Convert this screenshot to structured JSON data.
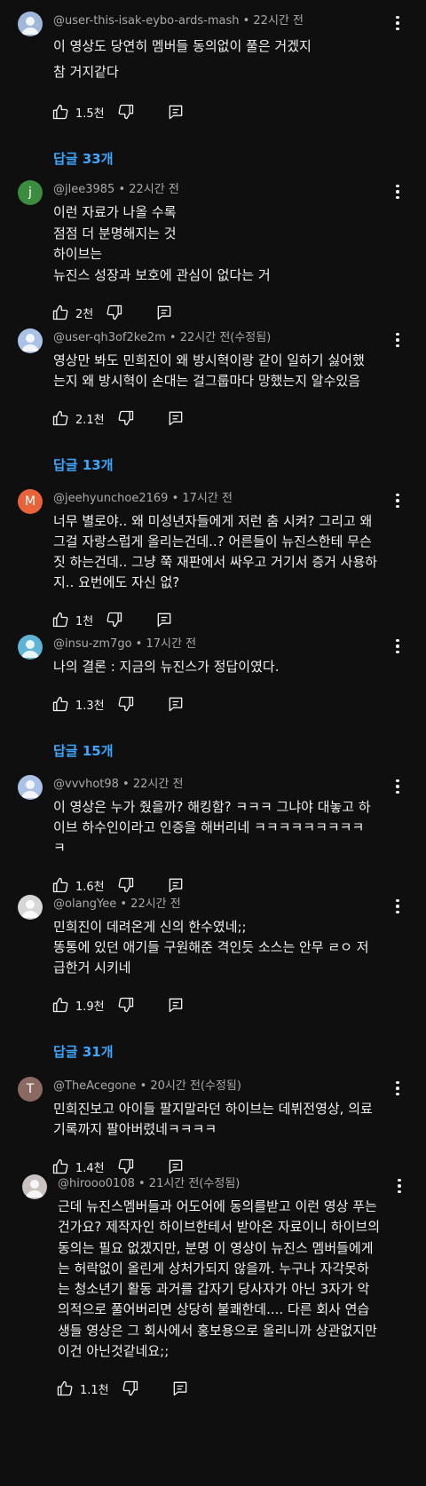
{
  "comments": [
    {
      "handle": "@user-this-isak-eybo-ards-mash",
      "time": "22시간 전",
      "avatar_letter": "",
      "avatar_color": "#9fb8d8",
      "lines": [
        "이 영상도 당연히 멤버들 동의없이 풀은 거겠지",
        "참 거지같다"
      ],
      "likes": "1.5천",
      "replies": "답글 33개"
    },
    {
      "handle": "@jlee3985",
      "time": "22시간 전",
      "avatar_letter": "j",
      "avatar_color": "#3b8c3f",
      "lines": [
        "이런 자료가 나올 수록",
        "점점 더 분명해지는 것",
        "하이브는",
        "뉴진스 성장과 보호에 관심이 없다는 거"
      ],
      "likes": "2천",
      "replies": ""
    },
    {
      "handle": "@user-qh3of2ke2m",
      "time": "22시간 전(수정됨)",
      "avatar_letter": "",
      "avatar_color": "#a9c2e6",
      "lines": [
        "영상만 봐도 민희진이 왜 방시혁이랑 같이 일하기 싫어했",
        "는지  왜 방시혁이 손대는 걸그룹마다 망했는지 알수있음"
      ],
      "likes": "2.1천",
      "replies": "답글 13개"
    },
    {
      "handle": "@jeehyunchoe2169",
      "time": "17시간 전",
      "avatar_letter": "M",
      "avatar_color": "#e8623a",
      "lines": [
        "너무 별로야.. 왜 미성년자들에게 저런 춤 시켜? 그리고 왜",
        "그걸 자랑스럽게 올리는건데..? 어른들이 뉴진스한테 무슨",
        "짓 하는건데.. 그냥 쭉 재판에서 싸우고 거기서 증거 사용하",
        "지.. 요번에도 자신 없?"
      ],
      "likes": "1천",
      "replies": ""
    },
    {
      "handle": "@insu-zm7go",
      "time": "17시간 전",
      "avatar_letter": "",
      "avatar_color": "#5fb3d4",
      "lines": [
        "나의 결론 : 지금의 뉴진스가 정답이였다."
      ],
      "likes": "1.3천",
      "replies": "답글 15개"
    },
    {
      "handle": "@vvvhot98",
      "time": "22시간 전",
      "avatar_letter": "",
      "avatar_color": "#a9c2e6",
      "lines": [
        "이 영상은 누가 줬을까? 해킹함? ㅋㅋㅋ 그냐야 대놓고 하",
        "이브 하수인이라고 인증을 해버리네 ㅋㅋㅋㅋㅋㅋㅋㅋㅋ",
        "ㅋ"
      ],
      "likes": "1.6천",
      "replies": ""
    },
    {
      "handle": "@olangYee",
      "time": "22시간 전",
      "avatar_letter": "",
      "avatar_color": "#d6d6d6",
      "lines": [
        "민희진이 데려온게 신의 한수였네;;",
        "똥통에 있던 애기들 구원해준 격인듯 소스는 안무 ㄹㅇ 저",
        "급한거 시키네"
      ],
      "likes": "1.9천",
      "replies": "답글 31개"
    },
    {
      "handle": "@TheAcegone",
      "time": "20시간 전(수정됨)",
      "avatar_letter": "T",
      "avatar_color": "#8a6a60",
      "lines": [
        "민희진보고 아이들 팔지말라던 하이브는 데뷔전영상, 의료",
        "기록까지 팔아버렸네ㅋㅋㅋㅋ"
      ],
      "likes": "1.4천",
      "replies": ""
    },
    {
      "handle": "@hirooo0108",
      "time": "21시간 전(수정됨)",
      "avatar_letter": "",
      "avatar_color": "#c9c2bf",
      "lines": [
        "근데 뉴진스멤버들과 어도어에 동의를받고 이런 영상 푸는",
        "건가요? 제작자인 하이브한테서 받아온 자료이니 하이브의",
        "동의는 필요 없겠지만, 분명 이 영상이 뉴진스 멤버들에게",
        "는 허락없이 올린게 상처가되지 않을까. 누구나 자각못하",
        "는 청소년기 활동 과거를 갑자기 당사자가 아닌 3자가 악",
        "의적으로 풀어버리면 상당히 불쾌한데.... 다른 회사 연습",
        "생들 영상은 그 회사에서 홍보용으로 올리니까 상관없지만",
        "이건 아닌것같네요;;"
      ],
      "likes": "1.1천",
      "replies": ""
    }
  ]
}
